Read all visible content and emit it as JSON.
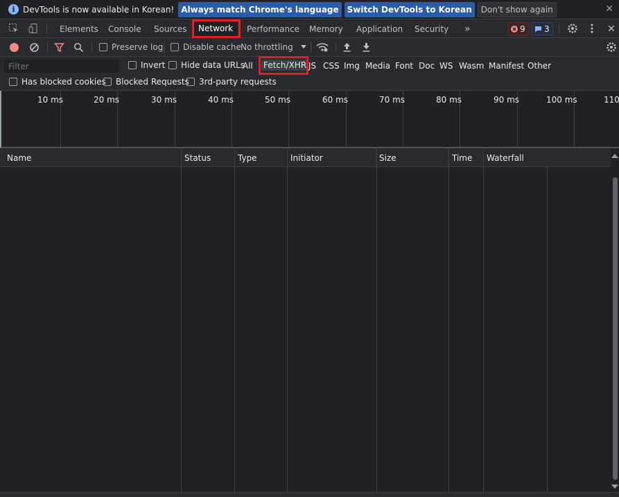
{
  "infobar": {
    "message": "DevTools is now available in Korean!",
    "match_language_label": "Always match Chrome's language",
    "switch_language_label": "Switch DevTools to Korean",
    "dismiss_label": "Don't show again",
    "info_glyph": "i",
    "close_glyph": "✕"
  },
  "tabs": {
    "items": [
      "Elements",
      "Console",
      "Sources",
      "Network",
      "Performance",
      "Memory",
      "Application",
      "Security"
    ],
    "more_glyph": "»",
    "active": "Network",
    "errors_count": "9",
    "messages_count": "3",
    "close_glyph": "✕"
  },
  "toolbar": {
    "preserve_log_label": "Preserve log",
    "disable_cache_label": "Disable cache",
    "throttling_value": "No throttling"
  },
  "filter": {
    "placeholder": "Filter",
    "invert_label": "Invert",
    "hide_data_urls_label": "Hide data URLs",
    "types": [
      "All",
      "Fetch/XHR",
      "JS",
      "CSS",
      "Img",
      "Media",
      "Font",
      "Doc",
      "WS",
      "Wasm",
      "Manifest",
      "Other"
    ],
    "selected_type": "Fetch/XHR",
    "has_blocked_cookies_label": "Has blocked cookies",
    "blocked_requests_label": "Blocked Requests",
    "third_party_label": "3rd-party requests"
  },
  "overview": {
    "ticks": [
      "10 ms",
      "20 ms",
      "30 ms",
      "40 ms",
      "50 ms",
      "60 ms",
      "70 ms",
      "80 ms",
      "90 ms",
      "100 ms",
      "110"
    ]
  },
  "table": {
    "columns": [
      "Name",
      "Status",
      "Type",
      "Initiator",
      "Size",
      "Time",
      "Waterfall"
    ],
    "rows": []
  },
  "colors": {
    "accent": "#8ab4f8",
    "highlight_box": "#e21f26",
    "background": "#202124",
    "toolbar": "#292a2d",
    "record": "#f28b82",
    "filter_icon": "#f28b82"
  }
}
